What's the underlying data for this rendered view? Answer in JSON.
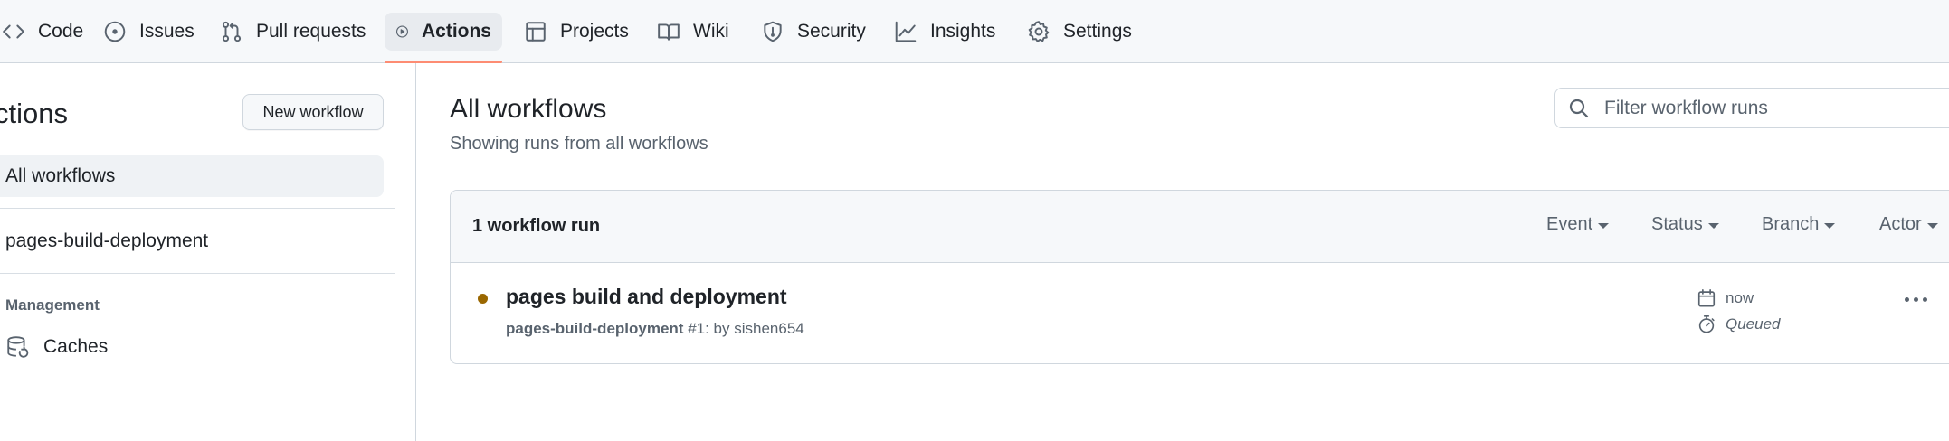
{
  "nav": {
    "tabs": [
      {
        "label": "Code",
        "icon": "code-icon"
      },
      {
        "label": "Issues",
        "icon": "issue-opened-icon"
      },
      {
        "label": "Pull requests",
        "icon": "git-pull-request-icon"
      },
      {
        "label": "Actions",
        "icon": "play-icon",
        "active": true
      },
      {
        "label": "Projects",
        "icon": "table-icon"
      },
      {
        "label": "Wiki",
        "icon": "book-icon"
      },
      {
        "label": "Security",
        "icon": "shield-icon"
      },
      {
        "label": "Insights",
        "icon": "graph-icon"
      },
      {
        "label": "Settings",
        "icon": "gear-icon"
      }
    ],
    "active_underline_color": "#fd8c73"
  },
  "sidebar": {
    "title": "ctions",
    "new_workflow_label": "New workflow",
    "items": [
      {
        "label": "All workflows",
        "selected": true
      },
      {
        "label": "pages-build-deployment",
        "selected": false
      }
    ],
    "management_heading": "Management",
    "caches_label": "Caches"
  },
  "main": {
    "title": "All workflows",
    "subtitle": "Showing runs from all workflows",
    "filter_placeholder": "Filter workflow runs",
    "runs_count": "1 workflow run",
    "filters": [
      "Event",
      "Status",
      "Branch",
      "Actor"
    ],
    "run": {
      "title": "pages build and deployment",
      "workflow": "pages-build-deployment",
      "meta_rest": " #1: by sishen654",
      "time": "now",
      "status": "Queued",
      "status_color": "#9a6700"
    }
  }
}
